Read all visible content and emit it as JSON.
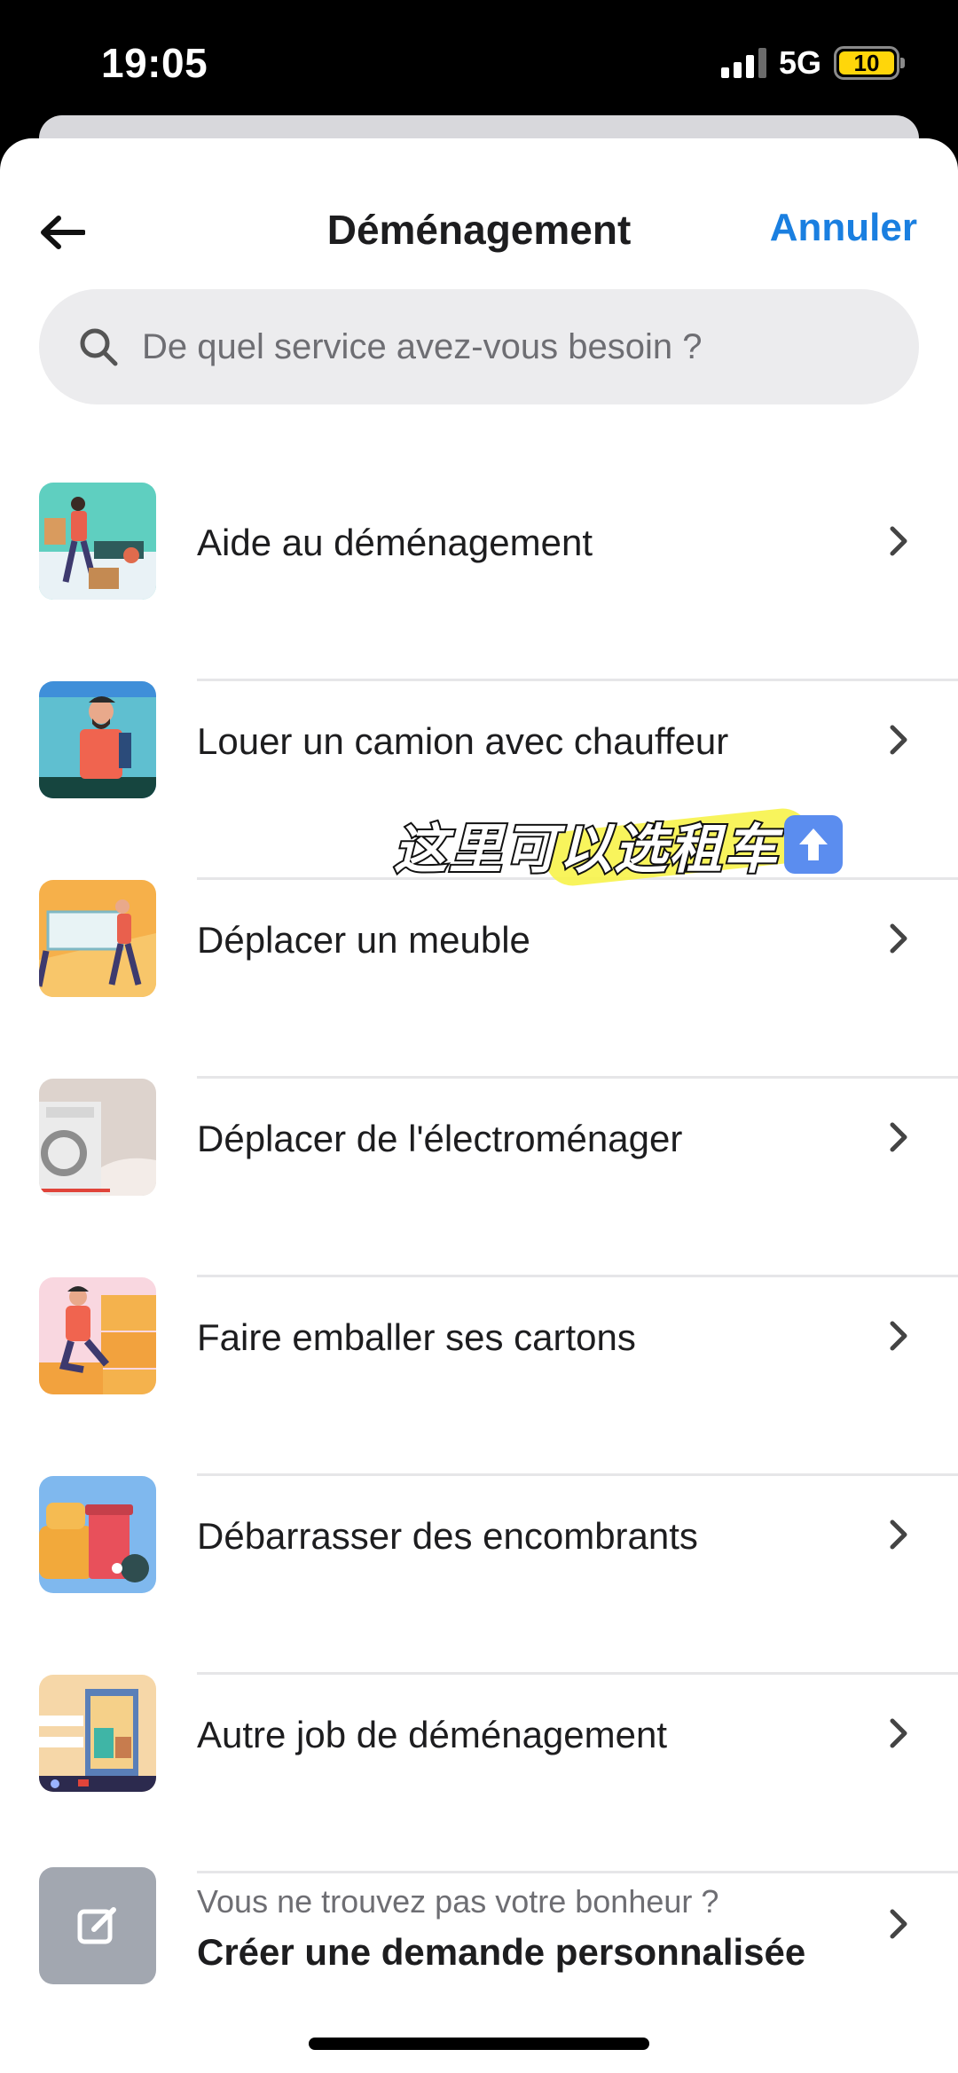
{
  "status_bar": {
    "time": "19:05",
    "network": "5G",
    "battery": "10"
  },
  "header": {
    "title": "Déménagement",
    "cancel_label": "Annuler"
  },
  "search": {
    "placeholder": "De quel service avez-vous besoin ?"
  },
  "services": [
    {
      "label": "Aide au déménagement",
      "icon": "moving-help-illustration"
    },
    {
      "label": "Louer un camion avec chauffeur",
      "icon": "truck-driver-illustration"
    },
    {
      "label": "Déplacer un meuble",
      "icon": "move-furniture-illustration"
    },
    {
      "label": "Déplacer de l'électroménager",
      "icon": "appliance-illustration"
    },
    {
      "label": "Faire emballer ses cartons",
      "icon": "packing-boxes-illustration"
    },
    {
      "label": "Débarrasser des encombrants",
      "icon": "bulky-waste-illustration"
    },
    {
      "label": "Autre job de déménagement",
      "icon": "other-job-illustration"
    }
  ],
  "custom_request": {
    "subtitle": "Vous ne trouvez pas votre bonheur ?",
    "title": "Créer une demande personnalisée"
  },
  "overlay": {
    "text": "这里可以选租车"
  },
  "colors": {
    "accent": "#1a7fe0",
    "highlight": "#f7f34a"
  }
}
